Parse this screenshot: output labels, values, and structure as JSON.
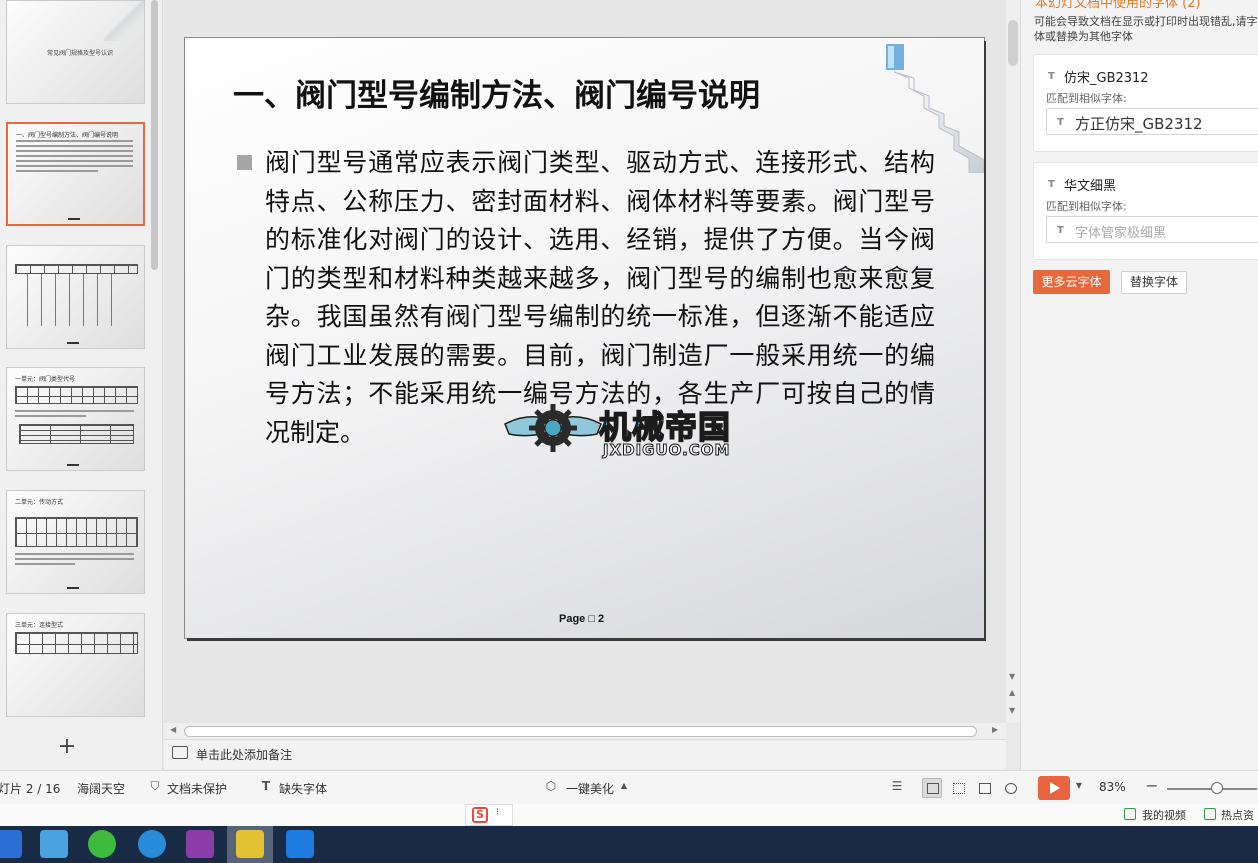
{
  "thumbnails": {
    "cover_title": "常见阀门规格及型号认识",
    "slide2_title": "一、阀门型号编制方法、阀门编号说明",
    "slide4_title": "一单元：阀门类型代号",
    "slide5_title": "二单元：传动方式",
    "slide6_title": "三单元：连接型式",
    "add_label": "+"
  },
  "slide": {
    "title": "一、阀门型号编制方法、阀门编号说明",
    "body": "阀门型号通常应表示阀门类型、驱动方式、连接形式、结构特点、公称压力、密封面材料、阀体材料等要素。阀门型号的标准化对阀门的设计、选用、经销，提供了方便。当今阀门的类型和材料种类越来越多，阀门型号的编制也愈来愈复杂。我国虽然有阀门型号编制的统一标准，但逐渐不能适应阀门工业发展的需要。目前，阀门制造厂一般采用统一的编号方法；不能采用统一编号方法的，各生产厂可按自己的情况制定。",
    "page": "Page □ 2",
    "watermark_cn": "机械帝国",
    "watermark_en": "JXDIGUO.COM"
  },
  "notes": {
    "placeholder": "单击此处添加备注"
  },
  "panel": {
    "heading": "本幻灯文档中使用的字体 (2)",
    "description": "可能会导致文档在显示或打印时出现错乱,请字体或替换为其他字体",
    "fonts": [
      {
        "name": "仿宋_GB2312",
        "match_label": "匹配到相似字体:",
        "match_value": "方正仿宋_GB2312",
        "is_placeholder": false
      },
      {
        "name": "华文细黑",
        "match_label": "匹配到相似字体:",
        "match_value": "字体管家极细黑",
        "is_placeholder": true
      }
    ],
    "more_fonts_button": "更多云字体",
    "replace_font_button": "替换字体"
  },
  "status": {
    "slide_counter": "灯片 2 / 16",
    "theme": "海阔天空",
    "protection": "文档未保护",
    "missing_font": "缺失字体",
    "beautify": "一键美化",
    "zoom": "83%",
    "zoom_level": 0.55
  },
  "strip": {
    "my_videos": "我的视频",
    "hot_news": "热点资"
  },
  "colors": {
    "accent": "#e6683c",
    "taskbar": "#1a2c45",
    "panel_heading": "#e07a2b"
  }
}
